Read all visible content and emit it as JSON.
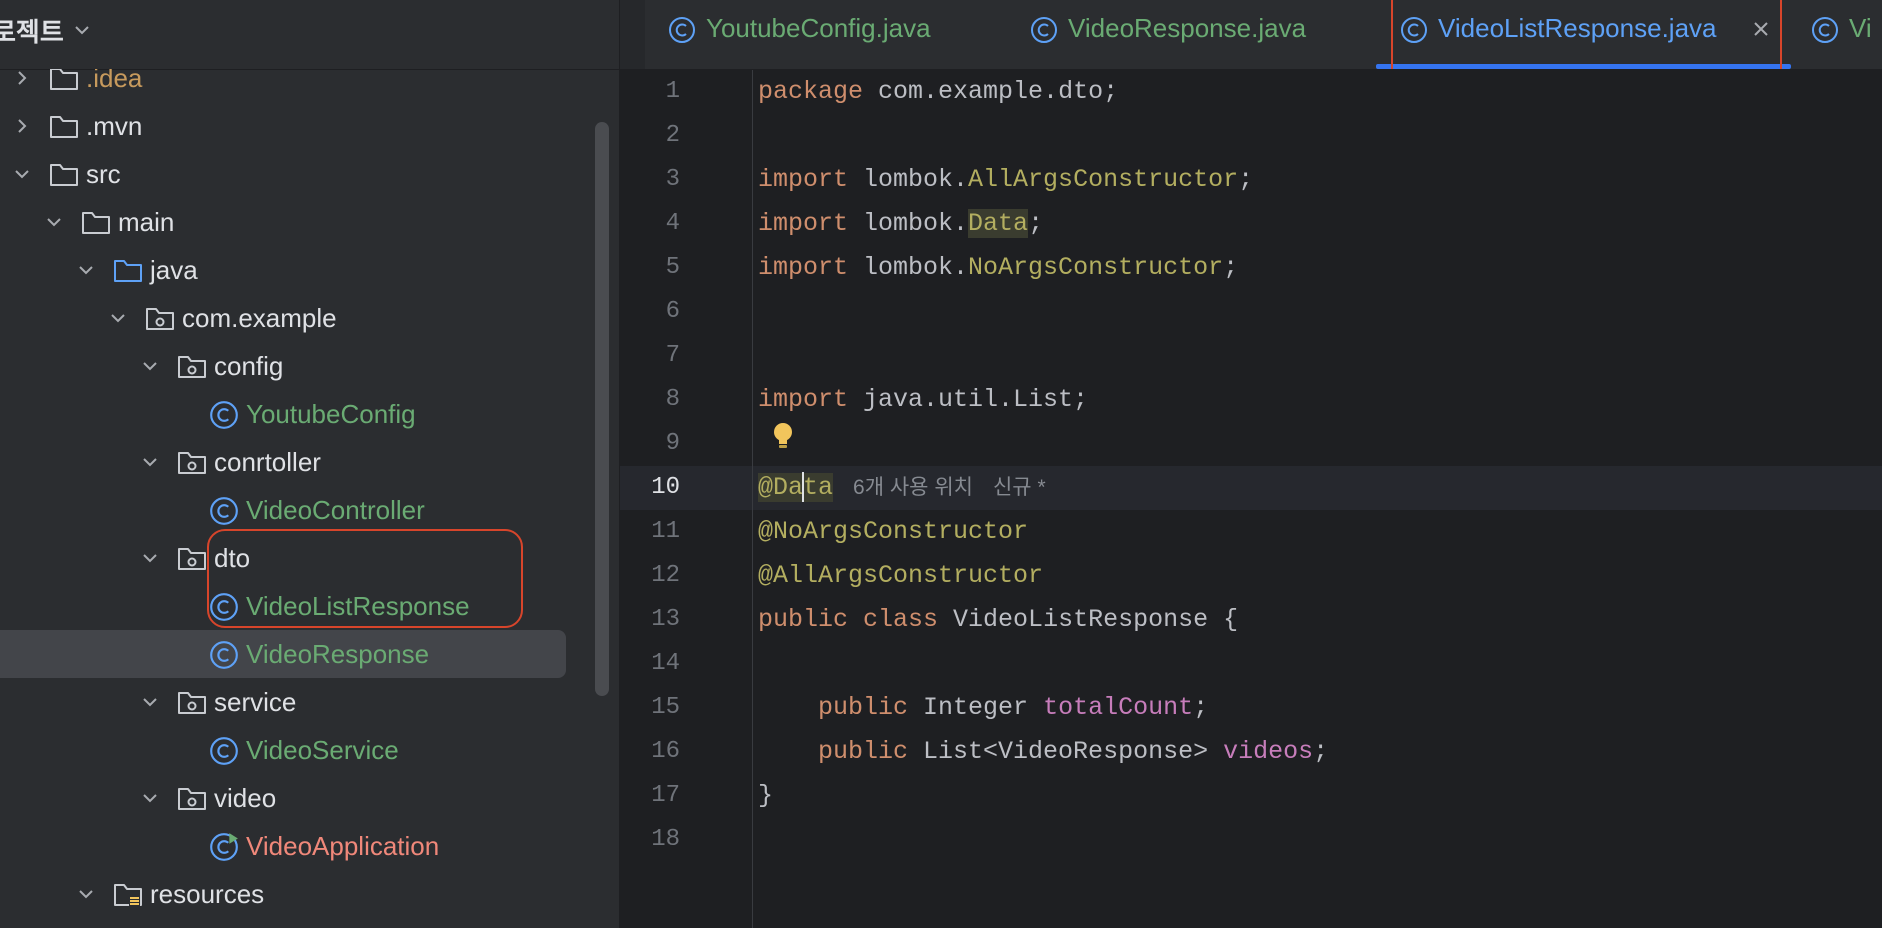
{
  "sidebar": {
    "title": "로젝트",
    "tree": [
      {
        "label": ".idea",
        "kind": "folder",
        "style": "muted",
        "depth": 0,
        "chevron": "right"
      },
      {
        "label": ".mvn",
        "kind": "folder",
        "depth": 0,
        "chevron": "right"
      },
      {
        "label": "src",
        "kind": "folder",
        "depth": 0,
        "chevron": "down"
      },
      {
        "label": "main",
        "kind": "folder",
        "depth": 1,
        "chevron": "down"
      },
      {
        "label": "java",
        "kind": "source-folder",
        "depth": 2,
        "chevron": "down"
      },
      {
        "label": "com.example",
        "kind": "package",
        "depth": 3,
        "chevron": "down"
      },
      {
        "label": "config",
        "kind": "package",
        "depth": 4,
        "chevron": "down"
      },
      {
        "label": "YoutubeConfig",
        "kind": "class",
        "depth": 5
      },
      {
        "label": "conrtoller",
        "kind": "package",
        "depth": 4,
        "chevron": "down"
      },
      {
        "label": "VideoController",
        "kind": "class",
        "depth": 5
      },
      {
        "label": "dto",
        "kind": "package",
        "depth": 4,
        "chevron": "down"
      },
      {
        "label": "VideoListResponse",
        "kind": "class",
        "depth": 5
      },
      {
        "label": "VideoResponse",
        "kind": "class",
        "depth": 5,
        "selected": true
      },
      {
        "label": "service",
        "kind": "package",
        "depth": 4,
        "chevron": "down"
      },
      {
        "label": "VideoService",
        "kind": "class",
        "depth": 5
      },
      {
        "label": "video",
        "kind": "package",
        "depth": 4,
        "chevron": "down"
      },
      {
        "label": "VideoApplication",
        "kind": "app-class",
        "depth": 5
      },
      {
        "label": "resources",
        "kind": "resources-folder",
        "depth": 2,
        "chevron": "down"
      }
    ]
  },
  "tabs": [
    {
      "label": "YoutubeConfig.java",
      "active": false
    },
    {
      "label": "VideoResponse.java",
      "active": false
    },
    {
      "label": "VideoListResponse.java",
      "active": true
    },
    {
      "label": "Vi",
      "active": false
    }
  ],
  "editor": {
    "current_line": 10,
    "line_numbers": [
      "1",
      "2",
      "3",
      "4",
      "5",
      "6",
      "7",
      "8",
      "9",
      "10",
      "11",
      "12",
      "13",
      "14",
      "15",
      "16",
      "17",
      "18"
    ],
    "code": {
      "l1_kw": "package",
      "l1_rest": " com.example.dto;",
      "import_kw": "import",
      "l3_pkg": " lombok.",
      "l3_cls": "AllArgsConstructor",
      "l3_end": ";",
      "l4_pkg": " lombok.",
      "l4_cls": "Data",
      "l4_end": ";",
      "l5_pkg": " lombok.",
      "l5_cls": "NoArgsConstructor",
      "l5_end": ";",
      "l8_rest": " java.util.List;",
      "l10_a": "@Da",
      "l10_b": "ta",
      "l10_hint1": "6개 사용 위치",
      "l10_hint2": "신규 *",
      "l11": "@NoArgsConstructor",
      "l12": "@AllArgsConstructor",
      "l13_kw1": "public",
      "l13_kw2": "class",
      "l13_rest": " VideoListResponse {",
      "l15_kw": "public",
      "l15_type": " Integer ",
      "l15_field": "totalCount",
      "l15_end": ";",
      "l16_kw": "public",
      "l16_type": " List<VideoResponse> ",
      "l16_field": "videos",
      "l16_end": ";",
      "l17": "}"
    }
  },
  "colors": {
    "accent": "#3574f0",
    "annotation_red": "#d7452b",
    "class_green": "#6aab73",
    "keyword_orange": "#cf8e6d",
    "annotation_yellow": "#b3ae60",
    "field_purple": "#c77dbb"
  }
}
